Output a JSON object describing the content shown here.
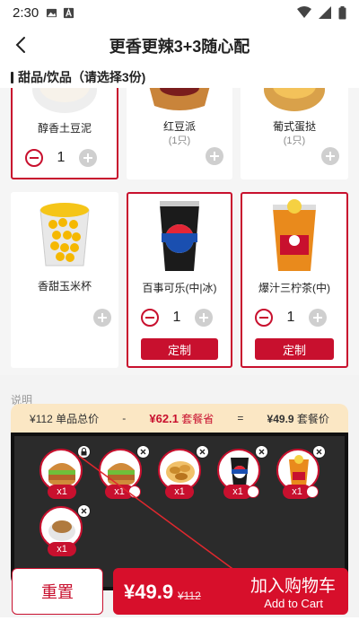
{
  "status_bar": {
    "time": "2:30"
  },
  "header": {
    "title": "更香更辣3+3随心配"
  },
  "section": {
    "title": "甜品/饮品（请选择3份)"
  },
  "products": [
    {
      "name": "醇香土豆泥",
      "qty_note": "",
      "count": "1",
      "selected": true
    },
    {
      "name": "红豆派",
      "qty_note": "(1只)",
      "count": "",
      "selected": false
    },
    {
      "name": "葡式蛋挞",
      "qty_note": "(1只)",
      "count": "",
      "selected": false
    },
    {
      "name": "香甜玉米杯",
      "qty_note": "",
      "count": "",
      "selected": false
    },
    {
      "name": "百事可乐(中|冰)",
      "qty_note": "",
      "count": "1",
      "selected": true,
      "custom_label": "定制"
    },
    {
      "name": "爆汁三柠茶(中)",
      "qty_note": "",
      "count": "1",
      "selected": true,
      "custom_label": "定制"
    }
  ],
  "note": "说明",
  "summary": {
    "total_label": "¥112 单品总价",
    "minus": "-",
    "save_amount": "¥62.1",
    "save_label": "套餐省",
    "equals": "=",
    "combo_amount": "¥49.9",
    "combo_label": "套餐价"
  },
  "tray_items": [
    {
      "name": "burger-1",
      "badge": "x1",
      "removable": false
    },
    {
      "name": "burger-2",
      "badge": "x1",
      "removable": true
    },
    {
      "name": "chicken-pieces",
      "badge": "x1",
      "removable": true
    },
    {
      "name": "pepsi",
      "badge": "x1",
      "removable": true
    },
    {
      "name": "lemon-tea",
      "badge": "x1",
      "removable": true
    },
    {
      "name": "mashed-potato",
      "badge": "x1",
      "removable": true
    }
  ],
  "footer": {
    "reset_label": "重置",
    "price": "¥49.9",
    "old_price": "¥112",
    "cta": "加入购物车",
    "cta_en": "Add to Cart"
  },
  "colors": {
    "accent": "#c8102e",
    "summary_bg": "#fbe7c4",
    "tray_bg": "#2b2b2b"
  }
}
